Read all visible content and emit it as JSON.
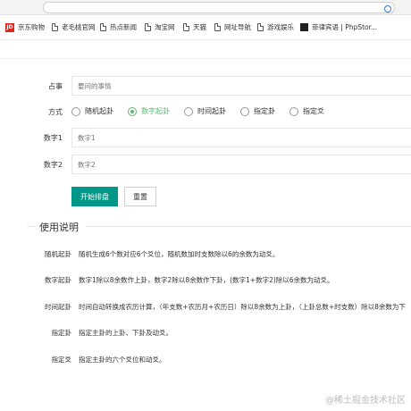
{
  "bookmarks": [
    {
      "icon": "jd-logo-icon",
      "label": "京东购物"
    },
    {
      "icon": "page-icon",
      "label": "老毛桃官网"
    },
    {
      "icon": "page-icon",
      "label": "热点新闻"
    },
    {
      "icon": "page-icon",
      "label": "淘宝网"
    },
    {
      "icon": "page-icon",
      "label": "天猫"
    },
    {
      "icon": "page-icon",
      "label": "网址导航"
    },
    {
      "icon": "page-icon",
      "label": "游戏娱乐"
    },
    {
      "icon": "phpstorm-icon",
      "label": "菲律宾语 | PhpStor..."
    }
  ],
  "form": {
    "event": {
      "label": "占事",
      "placeholder": "要问的事情"
    },
    "method": {
      "label": "方式",
      "options": [
        "随机起卦",
        "数字起卦",
        "时间起卦",
        "指定卦",
        "指定爻"
      ],
      "selected": "数字起卦"
    },
    "number1": {
      "label": "数字1",
      "placeholder": "数字1"
    },
    "number2": {
      "label": "数字2",
      "placeholder": "数字2"
    },
    "submit_label": "开始排盘",
    "reset_label": "重置"
  },
  "usage": {
    "title": "使用说明",
    "items": [
      {
        "label": "随机起卦",
        "text": "随机生成6个数对应6个爻位，随机数加时支数除以6的余数为动爻。"
      },
      {
        "label": "数字起卦",
        "text": "数字1除以8余数作上卦，数字2除以8余数作下卦，(数字1+数字2)除以6余数为动爻。"
      },
      {
        "label": "时间起卦",
        "text": "时间自动转换成农历计算，（年支数+农历月+农历日）除以8余数为上卦，（上卦总数+时支数）除以8余数为下"
      },
      {
        "label": "指定卦",
        "text": "指定主卦的上卦、下卦及动爻。"
      },
      {
        "label": "指定爻",
        "text": "指定主卦的六个爻位和动爻。"
      }
    ]
  },
  "watermark": "@稀土掘金技术社区",
  "colors": {
    "accent": "#5FB878",
    "primary_button": "#009688"
  }
}
